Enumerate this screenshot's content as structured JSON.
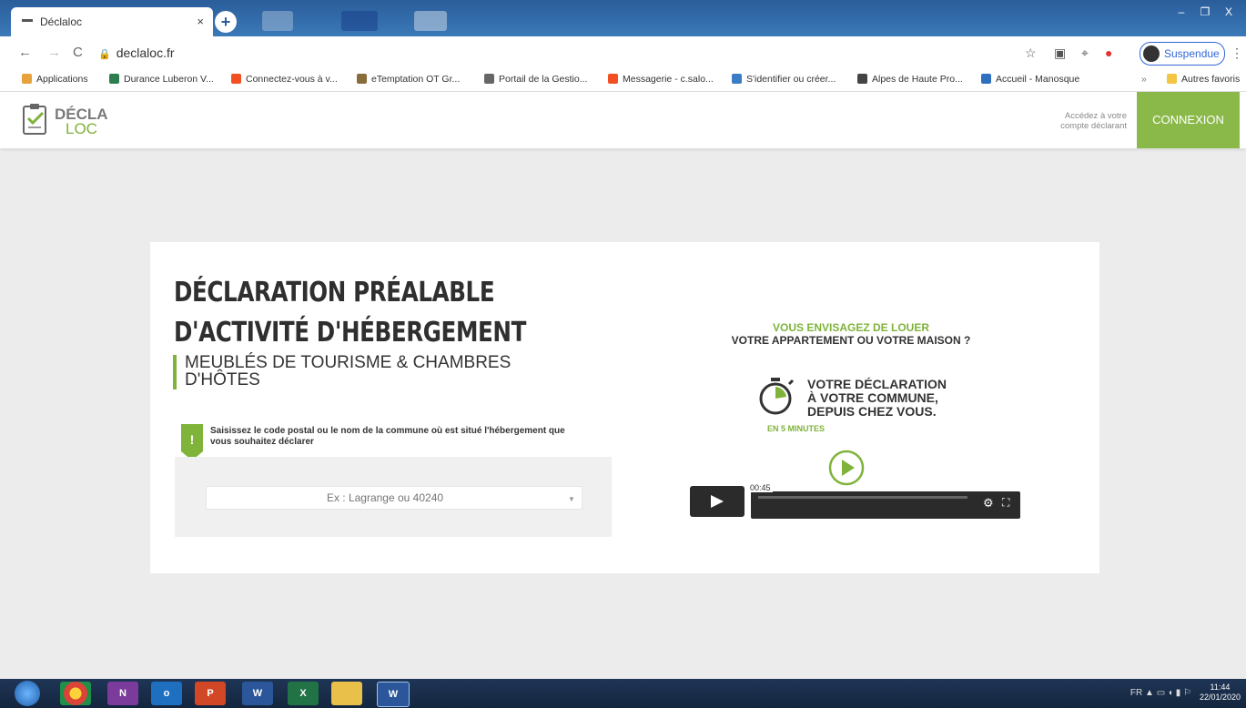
{
  "browser": {
    "tab_title": "Déclaloc",
    "tab_close": "×",
    "new_tab": "+",
    "url": "declaloc.fr",
    "profile_label": "Suspendue",
    "window_controls": [
      "–",
      "❐",
      "X"
    ],
    "bookmarks": [
      {
        "label": "Applications",
        "icon": "apps-grid-icon",
        "color": "#e8a23c"
      },
      {
        "label": "Durance Luberon V...",
        "icon": "leaf-icon",
        "color": "#2d7d4f"
      },
      {
        "label": "Connectez-vous à v...",
        "icon": "microsoft-icon",
        "color": "#f25022"
      },
      {
        "label": "eTemptation OT Gr...",
        "icon": "chart-icon",
        "color": "#8a6b3a"
      },
      {
        "label": "Portail de la Gestio...",
        "icon": "f-letter-icon",
        "color": "#666666"
      },
      {
        "label": "Messagerie - c.salo...",
        "icon": "microsoft-icon",
        "color": "#f25022"
      },
      {
        "label": "S'identifier ou créer...",
        "icon": "satellite-icon",
        "color": "#3b7dc4"
      },
      {
        "label": "Alpes de Haute Pro...",
        "icon": "globe-icon",
        "color": "#444444"
      },
      {
        "label": "Accueil - Manosque",
        "icon": "folder-icon",
        "color": "#2f6fc0"
      },
      {
        "label": "Autres favoris",
        "icon": "folder-icon",
        "color": "#f4c542"
      }
    ],
    "bookmarks_overflow": "»"
  },
  "site": {
    "logo_top": "DÉCLA",
    "logo_bottom": "LOC",
    "header_link": "Accédez à votre compte déclarant",
    "connexion": "CONNEXION"
  },
  "main": {
    "title_line1": "DÉCLARATION PRÉALABLE",
    "title_line2": "D'ACTIVITÉ D'HÉBERGEMENT",
    "subtitle": "MEUBLÉS DE TOURISME & CHAMBRES D'HÔTES",
    "hint_mark": "!",
    "hint": "Saisissez le code postal ou le nom de la commune où est situé l'hébergement que vous souhaitez déclarer",
    "search_placeholder": "Ex : Lagrange ou 40240"
  },
  "promo": {
    "line1": "VOUS ENVISAGEZ DE LOUER",
    "line2": "VOTRE APPARTEMENT OU VOTRE MAISON ?",
    "big1": "VOTRE DÉCLARATION",
    "big2": "À VOTRE COMMUNE,",
    "big3": "DEPUIS CHEZ VOUS.",
    "minutes": "EN 5 MINUTES",
    "video_time": "00:45"
  },
  "taskbar": {
    "apps": [
      "",
      "N",
      "o",
      "P",
      "W",
      "X",
      "",
      "W"
    ],
    "clock_time": "11:44",
    "clock_date": "22/01/2020",
    "tray": "FR"
  },
  "colors": {
    "accent_green": "#7fb33a",
    "connexion_bg": "#8ab94a"
  }
}
